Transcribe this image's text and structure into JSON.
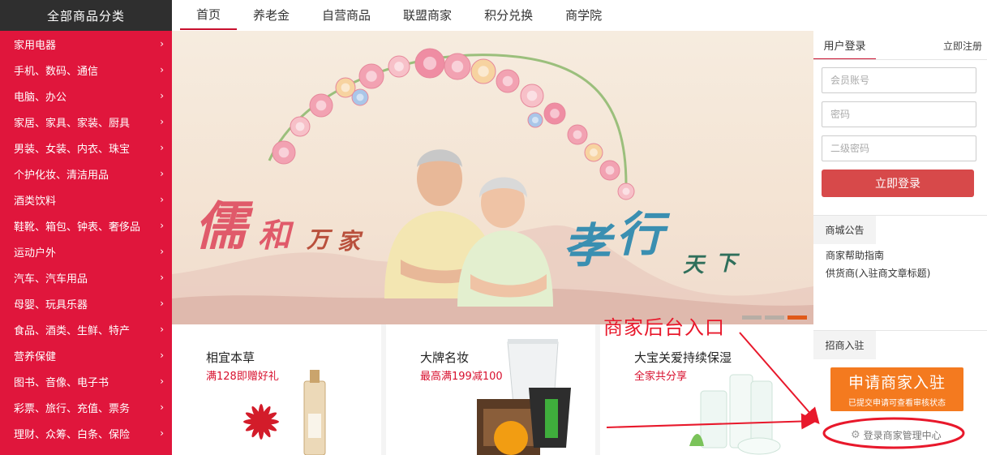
{
  "category": {
    "header": "全部商品分类",
    "items": [
      "家用电器",
      "手机、数码、通信",
      "电脑、办公",
      "家居、家具、家装、厨具",
      "男装、女装、内衣、珠宝",
      "个护化妆、清洁用品",
      "酒类饮料",
      "鞋靴、箱包、钟表、奢侈品",
      "运动户外",
      "汽车、汽车用品",
      "母婴、玩具乐器",
      "食品、酒类、生鲜、特产",
      "营养保健",
      "图书、音像、电子书",
      "彩票、旅行、充值、票务",
      "理财、众筹、白条、保险"
    ],
    "chevron": "›"
  },
  "nav": {
    "items": [
      "首页",
      "养老金",
      "自营商品",
      "联盟商家",
      "积分兑换",
      "商学院"
    ],
    "active_index": 0
  },
  "banner": {
    "left_text": [
      "儒",
      "和",
      "万",
      "家"
    ],
    "right_text": [
      "孝",
      "行",
      "天",
      "下"
    ],
    "slides": 3,
    "active_slide": 3
  },
  "promo": [
    {
      "title": "相宜本草",
      "sub": "满128即赠好礼"
    },
    {
      "title": "大牌名妆",
      "sub": "最高满199减100"
    },
    {
      "title": "大宝关爱持续保湿",
      "sub": "全家共分享"
    }
  ],
  "login": {
    "tab": "用户登录",
    "register": "立即注册",
    "account_placeholder": "会员账号",
    "password_placeholder": "密码",
    "second_password_placeholder": "二级密码",
    "submit": "立即登录"
  },
  "announcement": {
    "header": "商城公告",
    "items": [
      "商家帮助指南",
      "供货商(入驻商文章标题)"
    ]
  },
  "merchant": {
    "header": "招商入驻",
    "apply_main": "申请商家入驻",
    "apply_sub": "已提交申请可查看审核状态",
    "admin_link": "登录商家管理中心"
  },
  "annotation": {
    "text": "商家后台入口",
    "color": "#e8182b"
  },
  "colors": {
    "category_bg": "#e0163c",
    "category_header_bg": "#2f2f2f",
    "login_button": "#d7494a",
    "apply_button": "#f47a1f",
    "nav_active": "#c8102e"
  }
}
